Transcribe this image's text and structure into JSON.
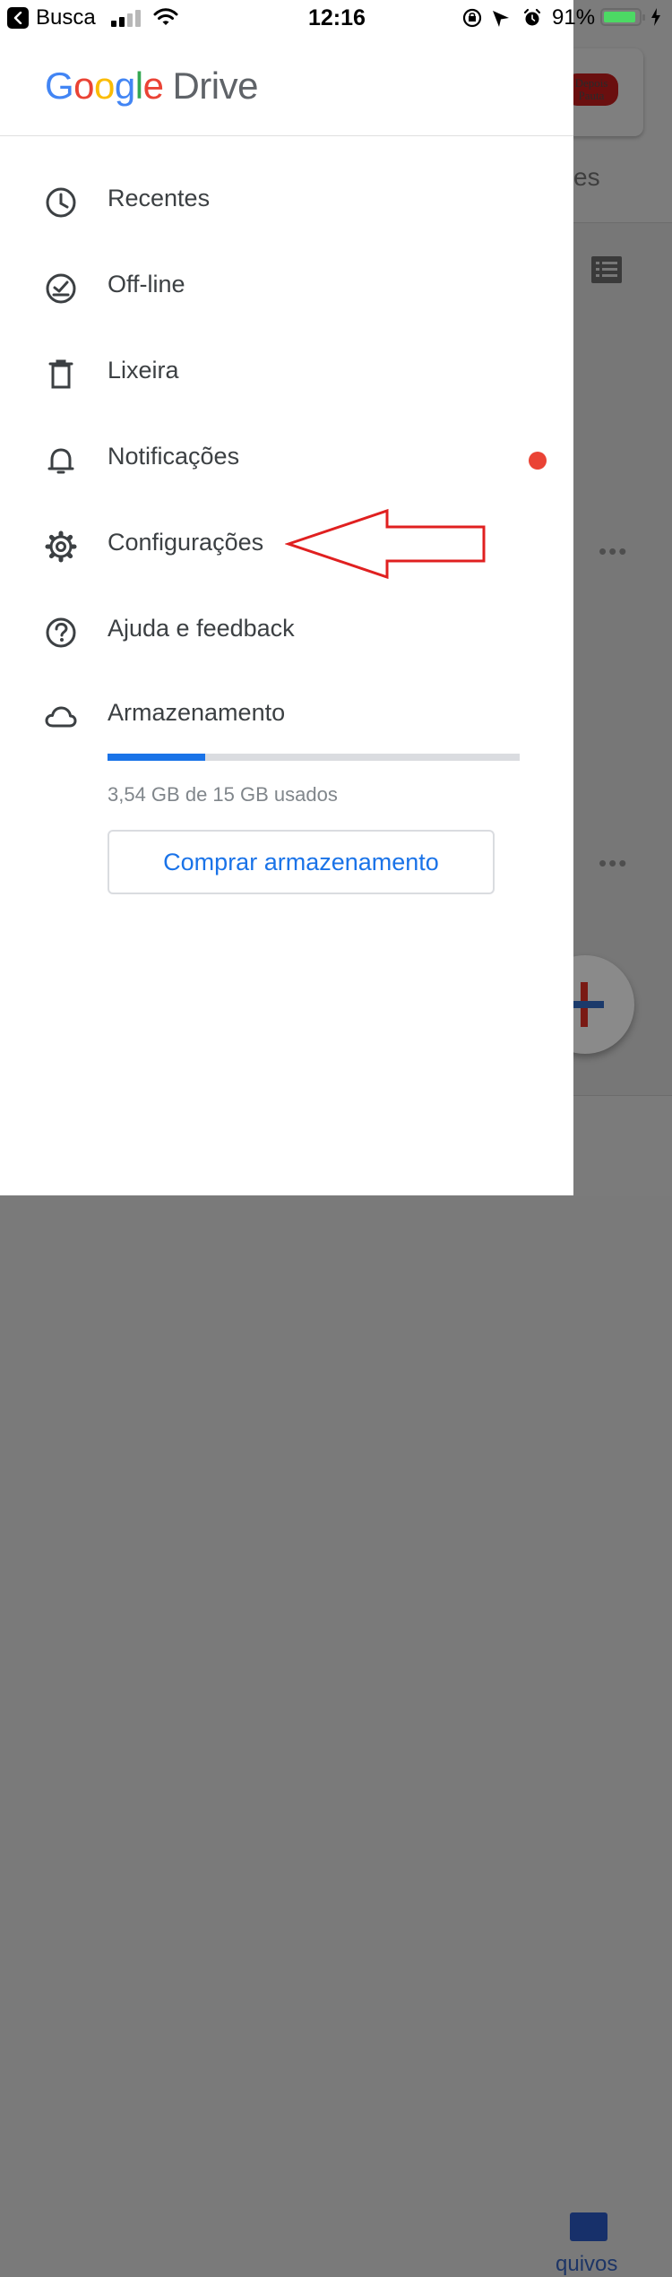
{
  "status_bar": {
    "back_label": "Busca",
    "time": "12:16",
    "battery_percent": "91%",
    "battery_level": 0.91
  },
  "drawer": {
    "logo": {
      "google": "Google",
      "product": "Drive"
    },
    "menu": [
      {
        "label": "Recentes",
        "icon": "clock-icon"
      },
      {
        "label": "Off-line",
        "icon": "offline-check-icon"
      },
      {
        "label": "Lixeira",
        "icon": "trash-icon"
      },
      {
        "label": "Notificações",
        "icon": "bell-icon",
        "has_badge": true
      },
      {
        "label": "Configurações",
        "icon": "gear-icon"
      },
      {
        "label": "Ajuda e feedback",
        "icon": "help-icon"
      },
      {
        "label": "Armazenamento",
        "icon": "cloud-icon"
      }
    ],
    "storage": {
      "used_text": "3,54 GB de 15 GB usados",
      "used_fraction": 0.236,
      "buy_button": "Comprar armazenamento"
    }
  },
  "background_app": {
    "tab_partial": "es",
    "bottom_nav_partial": "quivos"
  },
  "colors": {
    "accent": "#1a73e8",
    "badge": "#ea4335",
    "annotation_arrow": "#e02020",
    "scrim": "#777777"
  }
}
